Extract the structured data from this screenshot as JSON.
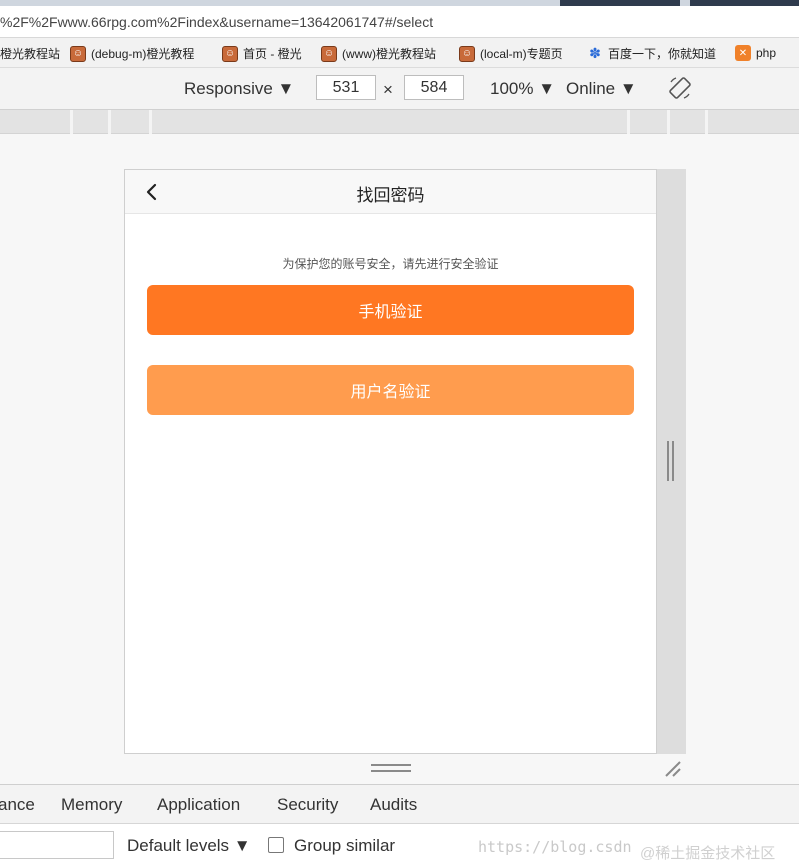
{
  "browser": {
    "url": "%2F%2Fwww.66rpg.com%2Findex&username=13642061747#/select",
    "bookmarks": [
      {
        "label": "橙光教程站",
        "icon": "none"
      },
      {
        "label": "(debug-m)橙光教程",
        "icon": "avatar-icon"
      },
      {
        "label": "首页 - 橙光",
        "icon": "avatar-icon"
      },
      {
        "label": "(www)橙光教程站",
        "icon": "avatar-icon"
      },
      {
        "label": "(local-m)专题页",
        "icon": "avatar-icon"
      },
      {
        "label": "百度一下，你就知道",
        "icon": "paw-icon"
      },
      {
        "label": "php",
        "icon": "x-icon"
      }
    ]
  },
  "device_toolbar": {
    "mode": "Responsive ▼",
    "width": "531",
    "times": "×",
    "height": "584",
    "zoom": "100% ▼",
    "network": "Online ▼"
  },
  "mobile": {
    "title": "找回密码",
    "hint": "为保护您的账号安全，请先进行安全验证",
    "btn_phone": "手机验证",
    "btn_username": "用户名验证",
    "colors": {
      "primary": "#ff7722",
      "secondary": "#ff9c4e"
    }
  },
  "devtools": {
    "tabs": [
      "ance",
      "Memory",
      "Application",
      "Security",
      "Audits"
    ],
    "levels": "Default levels ▼",
    "group_similar": "Group similar"
  },
  "watermark": {
    "url": "https://blog.csdn",
    "site": "@稀土掘金技术社区"
  }
}
